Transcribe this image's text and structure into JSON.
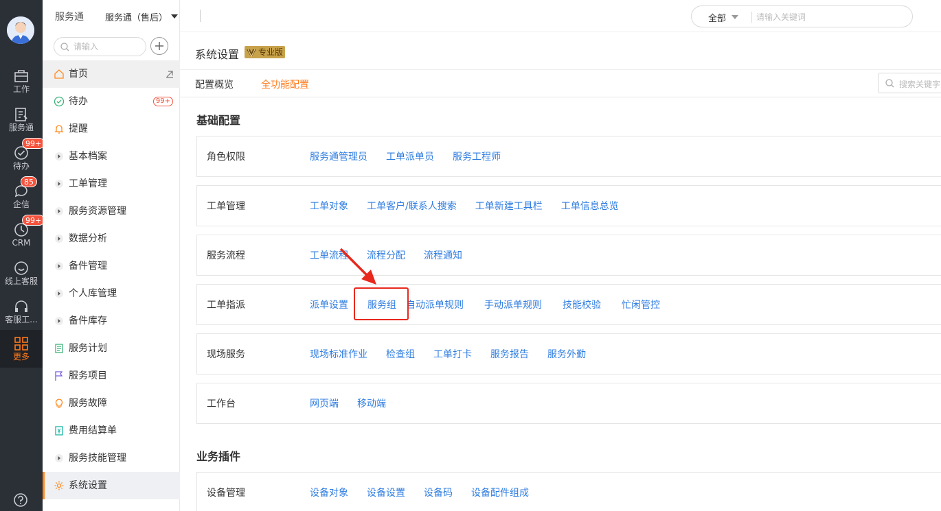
{
  "rail": {
    "items": [
      {
        "label": "工作",
        "icon": "briefcase-icon"
      },
      {
        "label": "服务通",
        "icon": "service-icon"
      },
      {
        "label": "待办",
        "icon": "check-circle-icon",
        "badge": "99+"
      },
      {
        "label": "企信",
        "icon": "chat-icon",
        "badge": "85"
      },
      {
        "label": "CRM",
        "icon": "crm-icon",
        "badge": "99+"
      },
      {
        "label": "线上客服",
        "icon": "support-icon"
      },
      {
        "label": "客服工...",
        "icon": "headset-icon"
      },
      {
        "label": "更多",
        "icon": "grid-icon"
      }
    ]
  },
  "sidebar": {
    "app_title": "服务通",
    "search_placeholder": "请输入",
    "items": [
      {
        "label": "首页",
        "icon": "home-icon"
      },
      {
        "label": "待办",
        "icon": "todo-icon",
        "badge": "99+"
      },
      {
        "label": "提醒",
        "icon": "bell-icon"
      },
      {
        "label": "基本档案",
        "icon": "caret-right-icon"
      },
      {
        "label": "工单管理",
        "icon": "caret-right-icon"
      },
      {
        "label": "服务资源管理",
        "icon": "caret-right-icon"
      },
      {
        "label": "数据分析",
        "icon": "caret-right-icon"
      },
      {
        "label": "备件管理",
        "icon": "caret-right-icon"
      },
      {
        "label": "个人库管理",
        "icon": "caret-right-icon"
      },
      {
        "label": "备件库存",
        "icon": "caret-right-icon"
      },
      {
        "label": "服务计划",
        "icon": "plan-icon"
      },
      {
        "label": "服务项目",
        "icon": "flag-icon"
      },
      {
        "label": "服务故障",
        "icon": "bulb-icon"
      },
      {
        "label": "费用结算单",
        "icon": "yen-icon"
      },
      {
        "label": "服务技能管理",
        "icon": "caret-right-icon"
      },
      {
        "label": "系统设置",
        "icon": "gear-icon"
      }
    ]
  },
  "topbar": {
    "app_switch": "服务通（售后）",
    "search_scope": "全部",
    "search_placeholder": "请输入关键词"
  },
  "page": {
    "title": "系统设置",
    "edition": "专业版",
    "tabs": [
      "配置概览",
      "全功能配置"
    ],
    "tab_search_placeholder": "搜索关键字"
  },
  "sections": [
    {
      "title": "基础配置",
      "rows": [
        {
          "label": "角色权限",
          "links": [
            "服务通管理员",
            "工单派单员",
            "服务工程师"
          ]
        },
        {
          "label": "工单管理",
          "links": [
            "工单对象",
            "工单客户/联系人搜索",
            "工单新建工具栏",
            "工单信息总览"
          ]
        },
        {
          "label": "服务流程",
          "links": [
            "工单流程",
            "流程分配",
            "流程通知"
          ]
        },
        {
          "label": "工单指派",
          "links": [
            "派单设置",
            "服务组",
            "自动派单规则",
            "手动派单规则",
            "技能校验",
            "忙闲管控"
          ]
        },
        {
          "label": "现场服务",
          "links": [
            "现场标准作业",
            "检查组",
            "工单打卡",
            "服务报告",
            "服务外勤"
          ]
        },
        {
          "label": "工作台",
          "links": [
            "网页端",
            "移动端"
          ]
        }
      ]
    },
    {
      "title": "业务插件",
      "rows": [
        {
          "label": "设备管理",
          "links": [
            "设备对象",
            "设备设置",
            "设备码",
            "设备配件组成"
          ]
        }
      ]
    }
  ],
  "colors": {
    "accent": "#ff7a1a",
    "link": "#2f7de1",
    "rail_bg": "#2b2f36",
    "highlight": "#e8281d"
  }
}
